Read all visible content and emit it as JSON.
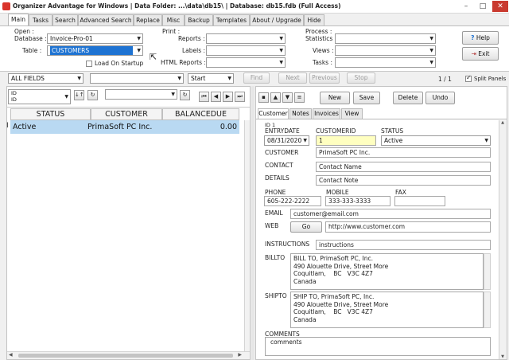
{
  "window": {
    "title": "Organizer Advantage for Windows | Data Folder: ...\\data\\db15\\ | Database: db15.fdb (Full Access)",
    "minimize": "–",
    "maximize": "□",
    "close": "✕"
  },
  "main_tabs": [
    "Main",
    "Tasks",
    "Search",
    "Advanced Search",
    "Replace",
    "Misc",
    "Backup",
    "Templates",
    "About / Upgrade",
    "Hide"
  ],
  "open_group": {
    "heading": "Open :",
    "database_label": "Database :",
    "database_value": "Invoice-Pro-01",
    "table_label": "Table :",
    "table_value": "CUSTOMERS",
    "load_on_startup": "Load On Startup"
  },
  "print_group": {
    "heading": "Print :",
    "reports_label": "Reports :",
    "labels_label": "Labels :",
    "html_reports_label": "HTML Reports :"
  },
  "process_group": {
    "heading": "Process :",
    "statistics_label": "Statistics :",
    "views_label": "Views :",
    "tasks_label": "Tasks :"
  },
  "help_button": "Help",
  "exit_button": "Exit",
  "search_bar": {
    "field_value": "ALL FIELDS",
    "mode_value": "Start",
    "find": "Find",
    "next": "Next",
    "previous": "Previous",
    "stop": "Stop",
    "record_counter": "1 / 1",
    "split_panels": "Split Panels"
  },
  "sort_bar": {
    "sort_field_line1": "ID",
    "sort_field_line2": "ID",
    "sort_icon": "↓↑",
    "refresh_icon": "↻"
  },
  "grid": {
    "columns": [
      "STATUS",
      "CUSTOMER",
      "BALANCEDUE"
    ],
    "rows": [
      {
        "status": "Active",
        "customer": "PrimaSoft PC Inc.",
        "balance": "0.00"
      }
    ]
  },
  "record_toolbar": {
    "new": "New",
    "save": "Save",
    "delete": "Delete",
    "undo": "Undo"
  },
  "sub_tabs": [
    "Customer",
    "Notes",
    "Invoices",
    "View"
  ],
  "form": {
    "id_label": "ID 1",
    "entrydate_label": "ENTRYDATE",
    "entrydate_value": "08/31/2020",
    "customerid_label": "CUSTOMERID",
    "customerid_value": "1",
    "status_label": "STATUS",
    "status_value": "Active",
    "customer_label": "CUSTOMER",
    "customer_value": "PrimaSoft PC Inc.",
    "contact_label": "CONTACT",
    "contact_value": "Contact Name",
    "details_label": "DETAILS",
    "details_value": "Contact Note",
    "phone_label": "PHONE",
    "phone_value": "605-222-2222",
    "mobile_label": "MOBILE",
    "mobile_value": "333-333-3333",
    "fax_label": "FAX",
    "fax_value": "",
    "email_label": "EMAIL",
    "email_value": "customer@email.com",
    "web_label": "WEB",
    "web_go": "Go",
    "web_value": "http://www.customer.com",
    "instructions_label": "INSTRUCTIONS",
    "instructions_value": "instructions",
    "billto_label": "BILLTO",
    "billto_value": "BILL TO, PrimaSoft PC, Inc.\n490 Alouette Drive, Street More\nCoquitlam,    BC   V3C 4Z7\nCanada",
    "shipto_label": "SHIPTO",
    "shipto_value": "SHIP TO, PrimaSoft PC, Inc.\n490 Alouette Drive, Street More\nCoquitlam,    BC   V3C 4Z7\nCanada",
    "comments_label": "COMMENTS",
    "comments_value": "comments"
  },
  "colors": {
    "selection": "#b9d9f2",
    "highlight": "#1e73d2",
    "customerid_bg": "#ffffc0"
  }
}
